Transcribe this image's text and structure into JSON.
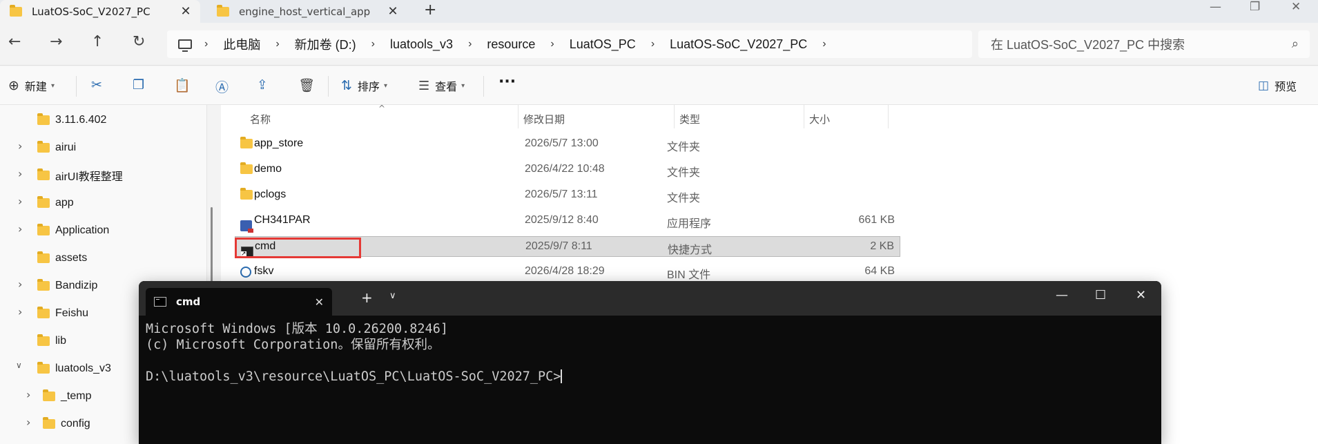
{
  "tabs": [
    {
      "label": "LuatOS-SoC_V2027_PC",
      "active": true
    },
    {
      "label": "engine_host_vertical_app",
      "active": false
    }
  ],
  "window_controls": {
    "minimize": "—",
    "restore": "❐",
    "close": "✕"
  },
  "nav": {
    "back": "←",
    "forward": "→",
    "up": "↑",
    "refresh": "↻"
  },
  "breadcrumb": [
    "此电脑",
    "新加卷 (D:)",
    "luatools_v3",
    "resource",
    "LuatOS_PC",
    "LuatOS-SoC_V2027_PC"
  ],
  "search": {
    "placeholder": "在 LuatOS-SoC_V2027_PC 中搜索"
  },
  "toolbar": {
    "new_label": "新建",
    "sort_label": "排序",
    "view_label": "查看",
    "more_label": "···",
    "preview_label": "预览"
  },
  "sidebar": {
    "items": [
      {
        "label": "3.11.6.402",
        "expandable": false
      },
      {
        "label": "airui",
        "expandable": true
      },
      {
        "label": "airUI教程整理",
        "expandable": true
      },
      {
        "label": "app",
        "expandable": true
      },
      {
        "label": "Application",
        "expandable": true
      },
      {
        "label": "assets",
        "expandable": false
      },
      {
        "label": "Bandizip",
        "expandable": true
      },
      {
        "label": "Feishu",
        "expandable": true
      },
      {
        "label": "lib",
        "expandable": false
      },
      {
        "label": "luatools_v3",
        "expandable": true,
        "expanded": true
      },
      {
        "label": "_temp",
        "expandable": true,
        "child": true
      },
      {
        "label": "config",
        "expandable": true,
        "child": true
      }
    ]
  },
  "columns": {
    "name": "名称",
    "date": "修改日期",
    "type": "类型",
    "size": "大小"
  },
  "files": [
    {
      "name": "app_store",
      "date": "2026/5/7 13:00",
      "type": "文件夹",
      "size": "",
      "icon": "folder-icon"
    },
    {
      "name": "demo",
      "date": "2026/4/22 10:48",
      "type": "文件夹",
      "size": "",
      "icon": "folder-icon"
    },
    {
      "name": "pclogs",
      "date": "2026/5/7 13:11",
      "type": "文件夹",
      "size": "",
      "icon": "folder-icon"
    },
    {
      "name": "CH341PAR",
      "date": "2025/9/12 8:40",
      "type": "应用程序",
      "size": "661 KB",
      "icon": "app-icon"
    },
    {
      "name": "cmd",
      "date": "2025/9/7 8:11",
      "type": "快捷方式",
      "size": "2 KB",
      "icon": "shortcut-icon",
      "selected": true
    },
    {
      "name": "fskv",
      "date": "2026/4/28 18:29",
      "type": "BIN 文件",
      "size": "64 KB",
      "icon": "bin-file-icon"
    }
  ],
  "terminal": {
    "tab_label": "cmd",
    "lines": [
      "Microsoft Windows [版本 10.0.26200.8246]",
      "(c) Microsoft Corporation。保留所有权利。",
      "",
      "D:\\luatools_v3\\resource\\LuatOS_PC\\LuatOS-SoC_V2027_PC>"
    ]
  },
  "colors": {
    "highlight_box": "#e53935",
    "terminal_bg": "#0c0c0c",
    "accent": "#2b6cb0"
  }
}
